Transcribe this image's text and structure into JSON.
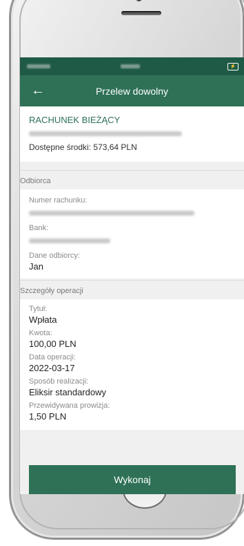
{
  "app": {
    "title": "Przelew dowolny",
    "accent_color": "#2e7157",
    "status_bar_color": "#1e5a45"
  },
  "account": {
    "name": "RACHUNEK BIEŻĄCY",
    "available_funds": "Dostępne środki: 573,64 PLN"
  },
  "recipient": {
    "section_title": "Odbiorca",
    "account_number_label": "Numer rachunku:",
    "bank_label": "Bank:",
    "recipient_data_label": "Dane odbiorcy:",
    "recipient_data_value": "Jan"
  },
  "operation": {
    "section_title": "Szczegóły operacji",
    "title_label": "Tytuł:",
    "title_value": "Wpłata",
    "amount_label": "Kwota:",
    "amount_value": "100,00 PLN",
    "date_label": "Data operacji:",
    "date_value": "2022-03-17",
    "method_label": "Sposób realizacji:",
    "method_value": "Eliksir standardowy",
    "fee_label": "Przewidywana prowizja:",
    "fee_value": "1,50 PLN"
  },
  "actions": {
    "execute_label": "Wykonaj",
    "back_icon": "arrow-left-icon"
  }
}
